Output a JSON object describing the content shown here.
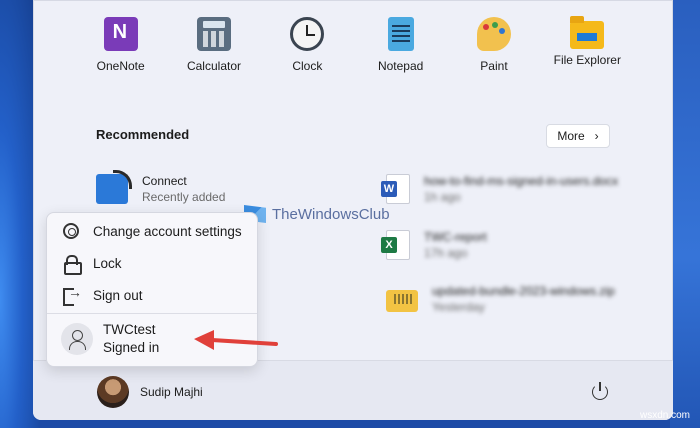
{
  "pinned_apps": [
    {
      "label": "OneNote",
      "icon": "onenote-icon"
    },
    {
      "label": "Calculator",
      "icon": "calculator-icon"
    },
    {
      "label": "Clock",
      "icon": "clock-icon"
    },
    {
      "label": "Notepad",
      "icon": "notepad-icon"
    },
    {
      "label": "Paint",
      "icon": "paint-icon"
    },
    {
      "label": "File Explorer",
      "icon": "file-explorer-icon"
    }
  ],
  "recommended": {
    "title": "Recommended",
    "more_label": "More",
    "items": [
      {
        "name": "Connect",
        "sub": "Recently added",
        "icon": "connect-icon"
      },
      {
        "name": "how-to-find-ms-signed-in-users.docx",
        "sub": "1h ago",
        "icon": "word-icon"
      },
      {
        "name": "TWC-report",
        "sub": "17h ago",
        "icon": "excel-icon"
      },
      {
        "name": "updated-bundle-2023-windows.zip",
        "sub": "Yesterday",
        "icon": "zip-folder-icon"
      }
    ]
  },
  "watermark": "TheWindowsClub",
  "account_menu": {
    "items": [
      {
        "label": "Change account settings",
        "icon": "gear-icon"
      },
      {
        "label": "Lock",
        "icon": "lock-icon"
      },
      {
        "label": "Sign out",
        "icon": "sign-out-icon"
      }
    ],
    "user": {
      "name": "TWCtest",
      "status": "Signed in"
    }
  },
  "footer": {
    "user_name": "Sudip Majhi",
    "power_icon": "power-icon"
  },
  "credit": "wsxdn.com",
  "colors": {
    "accent_arrow": "#e0403a",
    "menu_bg": "#eef0f8"
  }
}
